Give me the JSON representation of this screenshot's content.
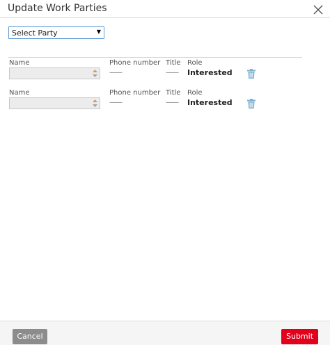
{
  "dialog": {
    "title": "Update Work Parties"
  },
  "select": {
    "value": "Select Party"
  },
  "parties": [
    {
      "name_label": "Name",
      "name_value": "",
      "phone_label": "Phone number",
      "phone_value": "——",
      "title_label": "Title",
      "title_value": "——",
      "role_label": "Role",
      "role_value": "Interested"
    },
    {
      "name_label": "Name",
      "name_value": "",
      "phone_label": "Phone number",
      "phone_value": "——",
      "title_label": "Title",
      "title_value": "——",
      "role_label": "Role",
      "role_value": "Interested"
    }
  ],
  "footer": {
    "cancel_label": "Cancel",
    "submit_label": "Submit"
  },
  "colors": {
    "accent_blue": "#5b9bd5",
    "submit_red": "#e2001a",
    "cancel_gray": "#8c8c8c",
    "trash_icon": "#7fb2d0"
  },
  "icons": {
    "close": "close-icon",
    "delete": "trash-icon",
    "select_arrow": "caret-down-icon",
    "spinner": "spinner-arrows-icon"
  }
}
